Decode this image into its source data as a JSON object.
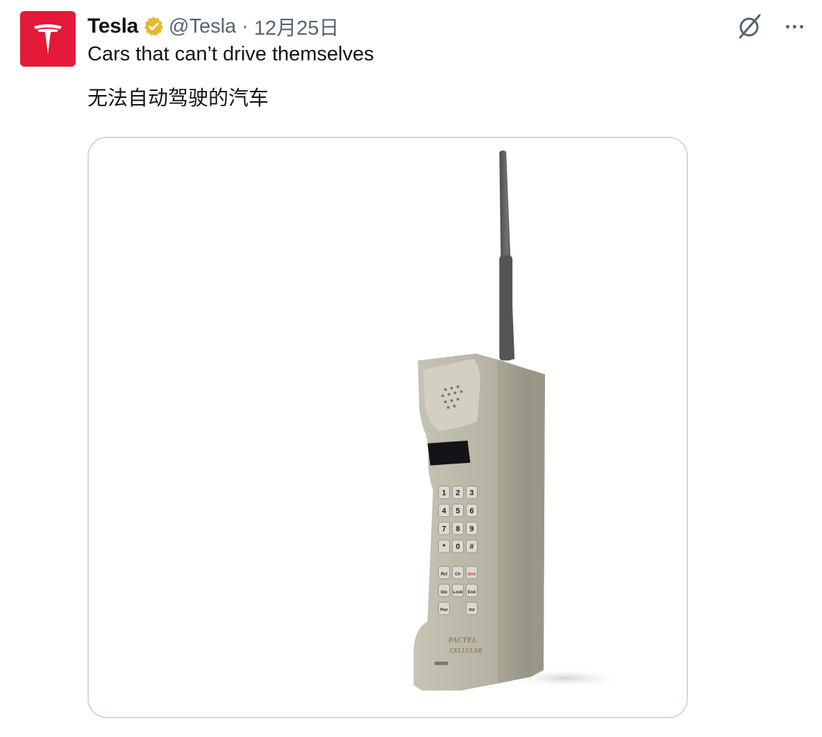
{
  "author": {
    "name": "Tesla",
    "handle": "@Tesla",
    "separator": "·",
    "date": "12月25日",
    "verified_badge": "gold-verified-badge-icon",
    "avatar_icon": "tesla-logo-icon",
    "avatar_color": "#e31937"
  },
  "tweet": {
    "line1": "Cars that can’t drive themselves",
    "line2": "无法自动驾驶的汽车"
  },
  "actions": {
    "grok_icon": "grok-icon",
    "more_icon": "more-options-icon"
  },
  "media": {
    "subject": "retro-brick-cellphone-image",
    "keypad": [
      "1",
      "2",
      "3",
      "4",
      "5",
      "6",
      "7",
      "8",
      "9",
      "*",
      "0",
      "#"
    ],
    "function_keys": [
      "Rcl",
      "Clr",
      "Snd",
      "Sto",
      "Lock",
      "End",
      "Pwr",
      "",
      "Vol"
    ],
    "brand": [
      "PACTEL",
      "CELLULAR"
    ]
  },
  "colors": {
    "text": "#0f1419",
    "secondary": "#536471",
    "border": "#cfd9de",
    "badge": "#e8b829"
  }
}
